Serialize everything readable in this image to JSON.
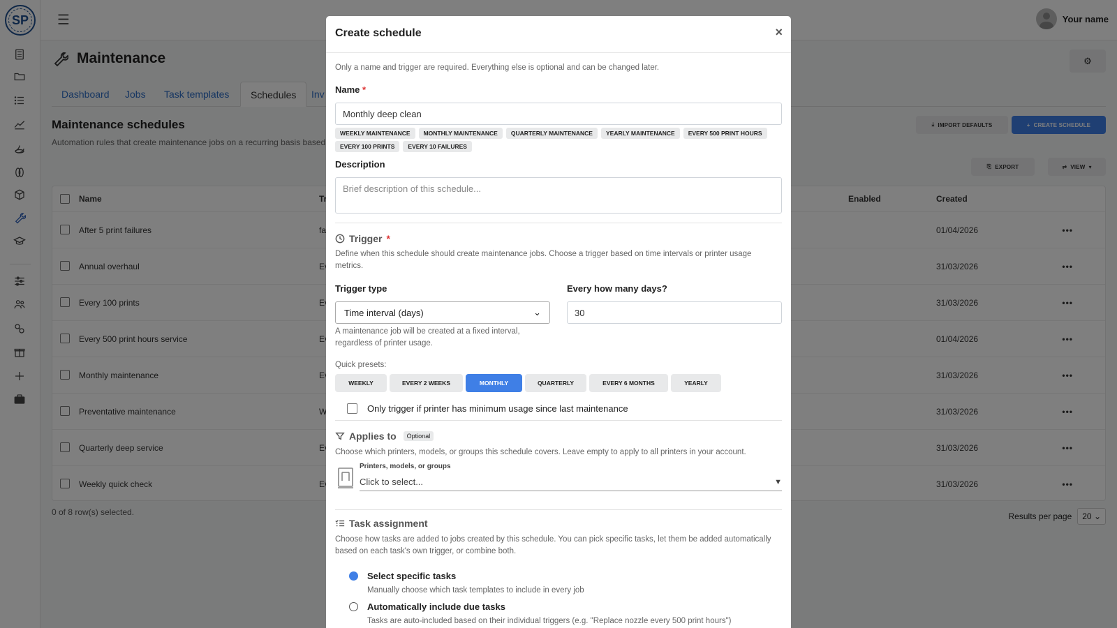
{
  "sidebar": {
    "logo_text": "SP",
    "icons": [
      "printer-icon",
      "folder-icon",
      "list-icon",
      "chart-icon",
      "spool-icon",
      "filament-icon",
      "cube-icon",
      "wrench-icon",
      "graduation-icon",
      "sliders-icon",
      "users-icon",
      "integrations-icon",
      "gift-icon",
      "plus-icon",
      "briefcase-icon"
    ]
  },
  "topbar": {
    "user_name": "Your name"
  },
  "page": {
    "title": "Maintenance",
    "tabs": [
      {
        "label": "Dashboard"
      },
      {
        "label": "Jobs"
      },
      {
        "label": "Task templates"
      },
      {
        "label": "Schedules"
      },
      {
        "label": "Inv"
      }
    ],
    "active_tab": "Schedules",
    "section_title": "Maintenance schedules",
    "section_desc": "Automation rules that create maintenance jobs on a recurring basis based o",
    "import_defaults": "IMPORT DEFAULTS",
    "create_schedule": "CREATE SCHEDULE",
    "export": "EXPORT",
    "view": "VIEW",
    "columns": {
      "name": "Name",
      "trigger": "Tr",
      "enabled": "Enabled",
      "created": "Created"
    },
    "rows": [
      {
        "name": "After 5 print failures",
        "trigger": "fa",
        "created": "01/04/2026"
      },
      {
        "name": "Annual overhaul",
        "trigger": "Ev",
        "created": "31/03/2026"
      },
      {
        "name": "Every 100 prints",
        "trigger": "Ev",
        "created": "31/03/2026"
      },
      {
        "name": "Every 500 print hours service",
        "trigger": "Ev",
        "created": "01/04/2026"
      },
      {
        "name": "Monthly maintenance",
        "trigger": "Ev",
        "created": "31/03/2026"
      },
      {
        "name": "Preventative maintenance",
        "trigger": "W",
        "created": "31/03/2026"
      },
      {
        "name": "Quarterly deep service",
        "trigger": "Ev",
        "created": "31/03/2026"
      },
      {
        "name": "Weekly quick check",
        "trigger": "Ev",
        "created": "31/03/2026"
      }
    ],
    "row_menu": "•••",
    "selection_text": "0 of 8 row(s) selected.",
    "results_per_page_label": "Results per page",
    "results_per_page": "20"
  },
  "modal": {
    "title": "Create schedule",
    "close": "×",
    "intro": "Only a name and trigger are required. Everything else is optional and can be changed later.",
    "name_label": "Name",
    "required_mark": "*",
    "name_value": "Monthly deep clean",
    "chips": [
      "WEEKLY MAINTENANCE",
      "MONTHLY MAINTENANCE",
      "QUARTERLY MAINTENANCE",
      "YEARLY MAINTENANCE",
      "EVERY 500 PRINT HOURS",
      "EVERY 100 PRINTS",
      "EVERY 10 FAILURES"
    ],
    "description_label": "Description",
    "description_placeholder": "Brief description of this schedule...",
    "trigger_title": "Trigger",
    "trigger_desc": "Define when this schedule should create maintenance jobs. Choose a trigger based on time intervals or printer usage metrics.",
    "trigger_type_label": "Trigger type",
    "trigger_type_value": "Time interval (days)",
    "days_label": "Every how many days?",
    "days_value": "30",
    "trigger_help": "A maintenance job will be created at a fixed interval, regardless of printer usage.",
    "presets_label": "Quick presets:",
    "presets": [
      "WEEKLY",
      "EVERY 2 WEEKS",
      "MONTHLY",
      "QUARTERLY",
      "EVERY 6 MONTHS",
      "YEARLY"
    ],
    "active_preset": "MONTHLY",
    "min_usage_label": "Only trigger if printer has minimum usage since last maintenance",
    "applies_title": "Applies to",
    "optional_badge": "Optional",
    "applies_desc": "Choose which printers, models, or groups this schedule covers. Leave empty to apply to all printers in your account.",
    "printers_label": "Printers, models, or groups",
    "printers_placeholder": "Click to select...",
    "task_title": "Task assignment",
    "task_desc": "Choose how tasks are added to jobs created by this schedule. You can pick specific tasks, let them be added automatically based on each task's own trigger, or combine both.",
    "option1_label": "Select specific tasks",
    "option1_desc": "Manually choose which task templates to include in every job",
    "option2_label": "Automatically include due tasks",
    "option2_desc": "Tasks are auto-included based on their individual triggers (e.g. \"Replace nozzle every 500 print hours\")"
  },
  "colors": {
    "accent": "#3f7fe6",
    "link": "#2c6cc4",
    "required": "#dd3333"
  }
}
